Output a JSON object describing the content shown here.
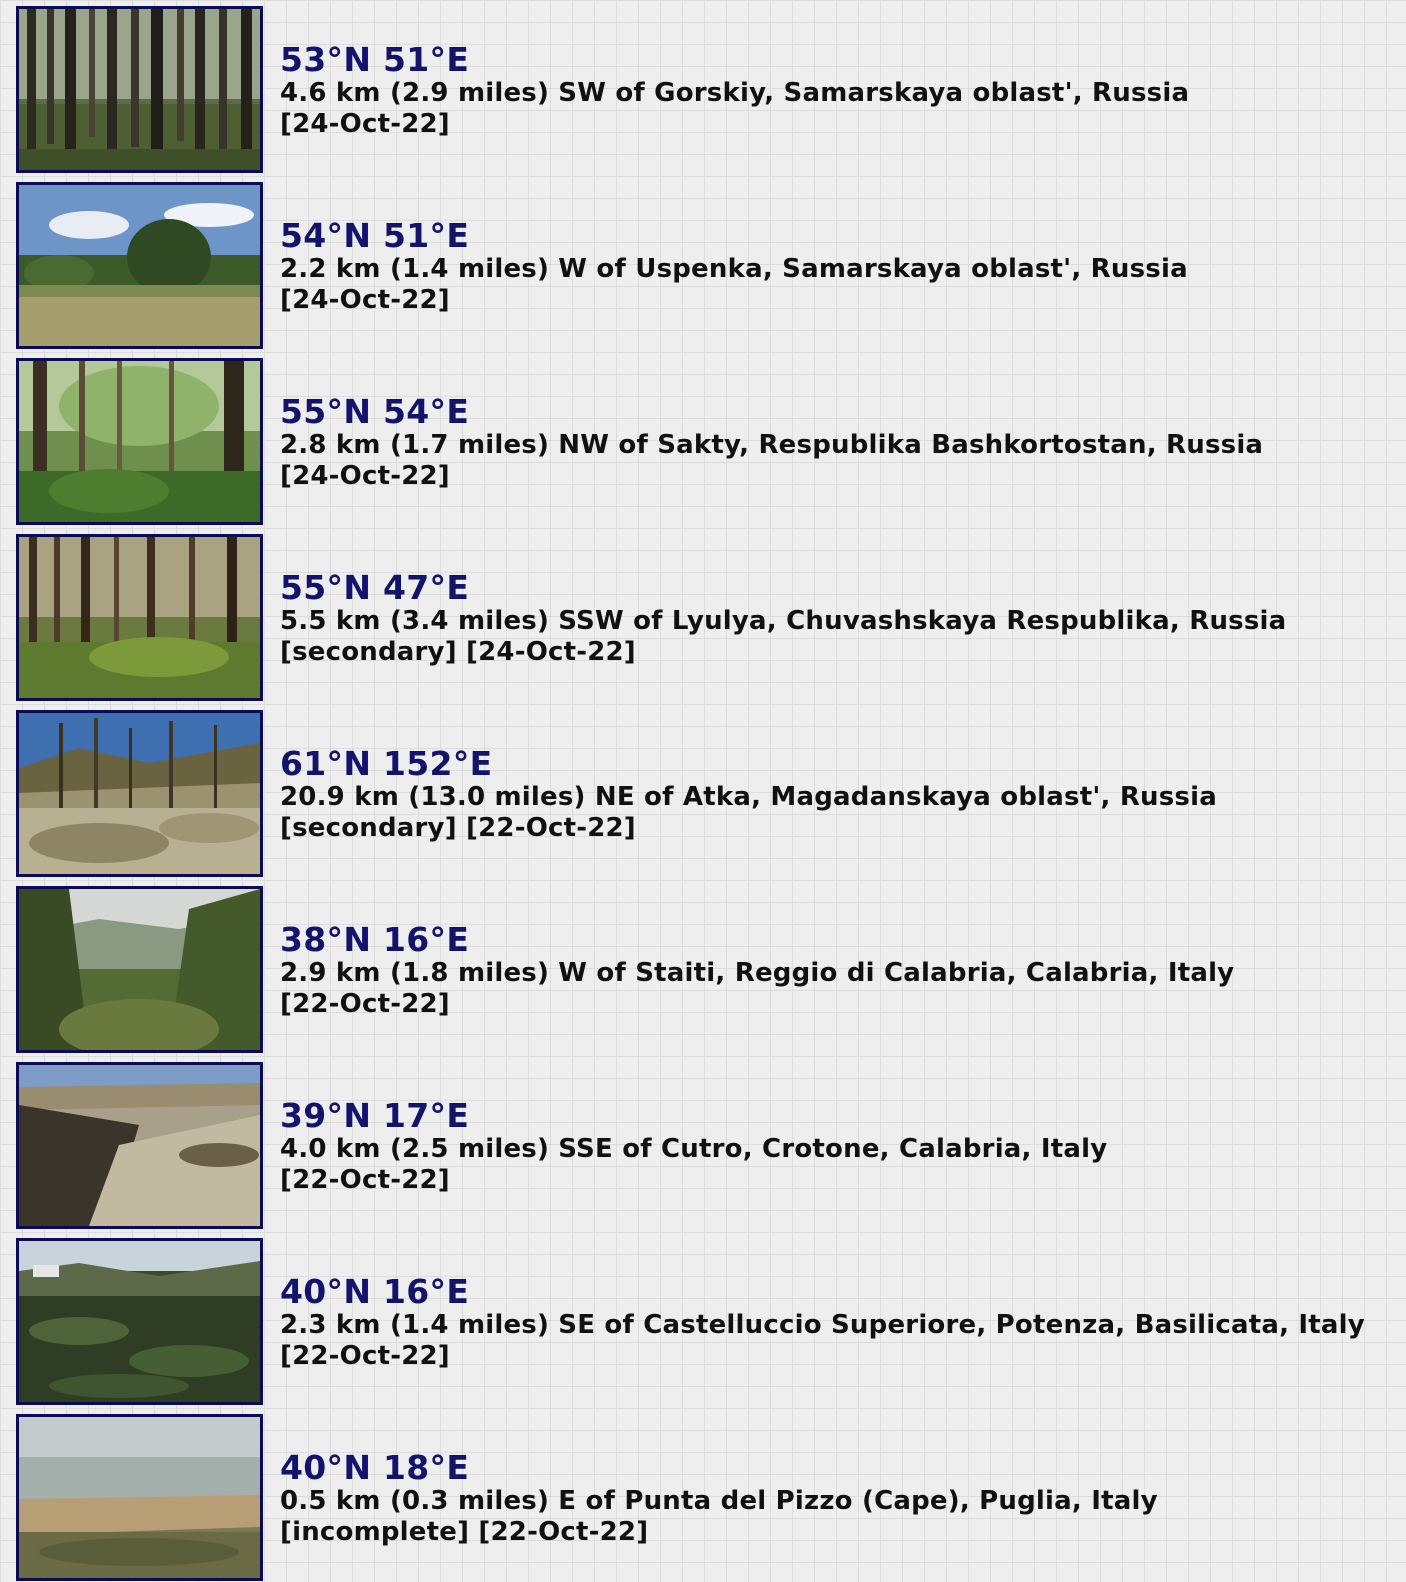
{
  "entries": [
    {
      "coords": "53°N 51°E",
      "place": "4.6 km (2.9 miles) SW of Gorskiy, Samarskaya oblast', Russia",
      "meta": "[24-Oct-22]",
      "photo": "pine-forest-photo"
    },
    {
      "coords": "54°N 51°E",
      "place": "2.2 km (1.4 miles) W of Uspenka, Samarskaya oblast', Russia",
      "meta": "[24-Oct-22]",
      "photo": "meadow-sky-photo"
    },
    {
      "coords": "55°N 54°E",
      "place": "2.8 km (1.7 miles) NW of Sakty, Respublika Bashkortostan, Russia",
      "meta": "[24-Oct-22]",
      "photo": "green-forest-photo"
    },
    {
      "coords": "55°N 47°E",
      "place": "5.5 km (3.4 miles) SSW of Lyulya, Chuvashskaya Respublika, Russia",
      "meta": "[secondary] [24-Oct-22]",
      "photo": "sunlit-forest-photo"
    },
    {
      "coords": "61°N 152°E",
      "place": "20.9 km (13.0 miles) NE of Atka, Magadanskaya oblast', Russia",
      "meta": "[secondary] [22-Oct-22]",
      "photo": "larch-hillside-photo"
    },
    {
      "coords": "38°N 16°E",
      "place": "2.9 km (1.8 miles) W of Staiti, Reggio di Calabria, Calabria, Italy",
      "meta": "[22-Oct-22]",
      "photo": "valley-shrub-photo"
    },
    {
      "coords": "39°N 17°E",
      "place": "4.0 km (2.5 miles) SSE of Cutro, Crotone, Calabria, Italy",
      "meta": "[22-Oct-22]",
      "photo": "badlands-photo"
    },
    {
      "coords": "40°N 16°E",
      "place": "2.3 km (1.4 miles) SE of Castelluccio Superiore, Potenza, Basilicata, Italy",
      "meta": "[22-Oct-22]",
      "photo": "crop-field-photo"
    },
    {
      "coords": "40°N 18°E",
      "place": "0.5 km (0.3 miles) E of Punta del Pizzo (Cape), Puglia, Italy",
      "meta": "[incomplete] [22-Oct-22]",
      "photo": "coast-sea-photo"
    }
  ]
}
